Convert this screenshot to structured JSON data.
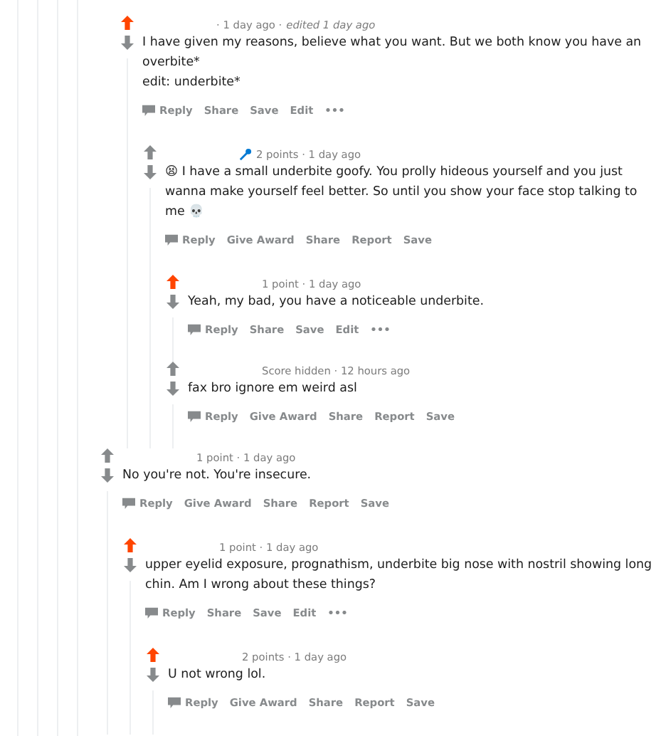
{
  "comments": [
    {
      "parent_hidden": true,
      "upvoted": true,
      "flair": false,
      "meta": "· 1 day ago ·",
      "edited": "edited 1 day ago",
      "body": [
        "I have given my reasons, believe what you want. But we both know you have an overbite*",
        "edit: underbite*"
      ],
      "actions": [
        {
          "kind": "reply",
          "label": "Reply"
        },
        {
          "kind": "text",
          "label": "Share"
        },
        {
          "kind": "text",
          "label": "Save"
        },
        {
          "kind": "text",
          "label": "Edit"
        },
        {
          "kind": "more",
          "label": "•••"
        }
      ],
      "children": [
        {
          "upvoted": false,
          "flair": true,
          "meta": "2 points · 1 day ago",
          "body": [
            "😫 I have a small underbite goofy. You prolly hideous yourself and you just wanna make yourself feel better. So until you show your face stop talking to me 💀"
          ],
          "actions": [
            {
              "kind": "reply",
              "label": "Reply"
            },
            {
              "kind": "text",
              "label": "Give Award"
            },
            {
              "kind": "text",
              "label": "Share"
            },
            {
              "kind": "text",
              "label": "Report"
            },
            {
              "kind": "text",
              "label": "Save"
            }
          ],
          "children": [
            {
              "upvoted": true,
              "flair": false,
              "meta": "1 point · 1 day ago",
              "body": [
                "Yeah, my bad, you have a noticeable underbite."
              ],
              "actions": [
                {
                  "kind": "reply",
                  "label": "Reply"
                },
                {
                  "kind": "text",
                  "label": "Share"
                },
                {
                  "kind": "text",
                  "label": "Save"
                },
                {
                  "kind": "text",
                  "label": "Edit"
                },
                {
                  "kind": "more",
                  "label": "•••"
                }
              ]
            },
            {
              "upvoted": false,
              "flair": false,
              "meta": "Score hidden · 12 hours ago",
              "body": [
                "fax bro ignore em weird asl"
              ],
              "actions": [
                {
                  "kind": "reply",
                  "label": "Reply"
                },
                {
                  "kind": "text",
                  "label": "Give Award"
                },
                {
                  "kind": "text",
                  "label": "Share"
                },
                {
                  "kind": "text",
                  "label": "Report"
                },
                {
                  "kind": "text",
                  "label": "Save"
                }
              ]
            }
          ]
        }
      ]
    },
    {
      "parent_hidden": false,
      "upvoted": false,
      "flair": false,
      "meta": "1 point · 1 day ago",
      "body": [
        "No you're not. You're insecure."
      ],
      "actions": [
        {
          "kind": "reply",
          "label": "Reply"
        },
        {
          "kind": "text",
          "label": "Give Award"
        },
        {
          "kind": "text",
          "label": "Share"
        },
        {
          "kind": "text",
          "label": "Report"
        },
        {
          "kind": "text",
          "label": "Save"
        }
      ],
      "children": [
        {
          "upvoted": true,
          "flair": false,
          "meta": "1 point · 1 day ago",
          "body": [
            "upper eyelid exposure, prognathism, underbite big nose with nostril showing long chin. Am I wrong about these things?"
          ],
          "actions": [
            {
              "kind": "reply",
              "label": "Reply"
            },
            {
              "kind": "text",
              "label": "Share"
            },
            {
              "kind": "text",
              "label": "Save"
            },
            {
              "kind": "text",
              "label": "Edit"
            },
            {
              "kind": "more",
              "label": "•••"
            }
          ],
          "children": [
            {
              "upvoted": true,
              "flair": false,
              "meta": "2 points · 1 day ago",
              "body": [
                "U not wrong lol."
              ],
              "actions": [
                {
                  "kind": "reply",
                  "label": "Reply"
                },
                {
                  "kind": "text",
                  "label": "Give Award"
                },
                {
                  "kind": "text",
                  "label": "Share"
                },
                {
                  "kind": "text",
                  "label": "Report"
                },
                {
                  "kind": "text",
                  "label": "Save"
                }
              ]
            }
          ]
        }
      ]
    }
  ]
}
